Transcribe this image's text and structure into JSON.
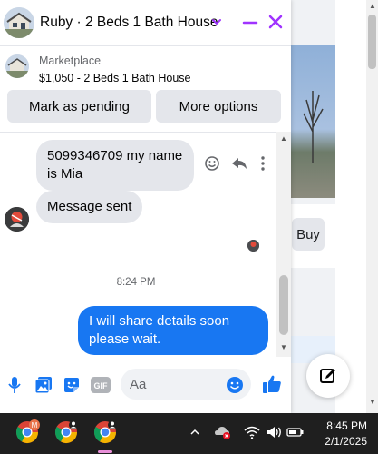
{
  "chat": {
    "header": {
      "title": "Ruby · 2 Beds 1 Bath House"
    },
    "listing": {
      "source": "Marketplace",
      "title": "$1,050 - 2 Beds 1 Bath House",
      "pending_label": "Mark as pending",
      "more_label": "More options"
    },
    "messages": {
      "incoming": [
        "5099346709 my name is Mia",
        "Message sent"
      ],
      "timestamp": "8:24 PM",
      "outgoing": "I will share details soon please wait."
    },
    "composer": {
      "placeholder": "Aa",
      "gif_label": "GIF"
    }
  },
  "background": {
    "buy_label": "Buy"
  },
  "taskbar": {
    "time": "8:45 PM",
    "date": "2/1/2025"
  },
  "colors": {
    "accent": "#1877f2",
    "brand_purple": "#a033ff",
    "bubble_in": "#e4e6eb"
  }
}
